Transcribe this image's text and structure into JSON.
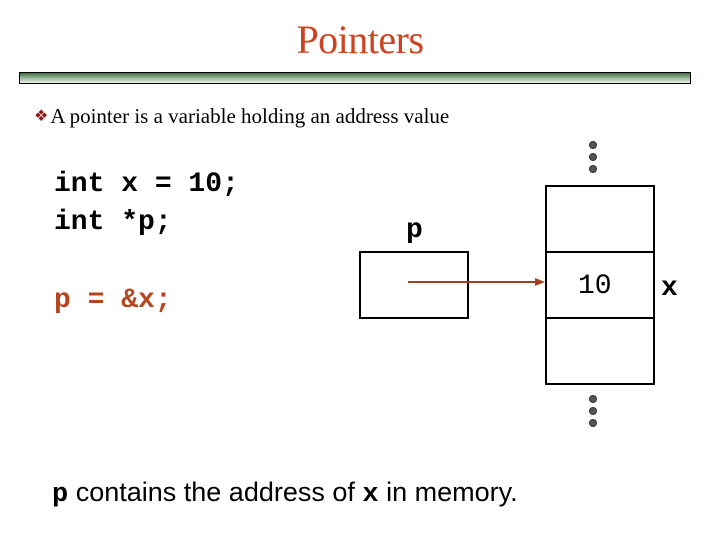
{
  "slide": {
    "title": "Pointers",
    "bullet_icon": "diamond-cluster-icon",
    "bullet_text": "A pointer is a variable holding an address value"
  },
  "code": {
    "line1": "int x = 10;",
    "line2": "int *p;",
    "line3": "p = &x;"
  },
  "diagram": {
    "pointer_label": "p",
    "memory_value": "10",
    "memory_label": "x",
    "memory_cells": 3,
    "colors": {
      "arrow": "#a0401f",
      "dots": "#555555"
    }
  },
  "caption": {
    "var_p": "p",
    "text1": " contains the address of ",
    "var_x": "x",
    "text2": " in memory."
  },
  "colors": {
    "title": "#cc4422",
    "assign_code": "#b5461e",
    "bullet": "#8b1a1a"
  }
}
